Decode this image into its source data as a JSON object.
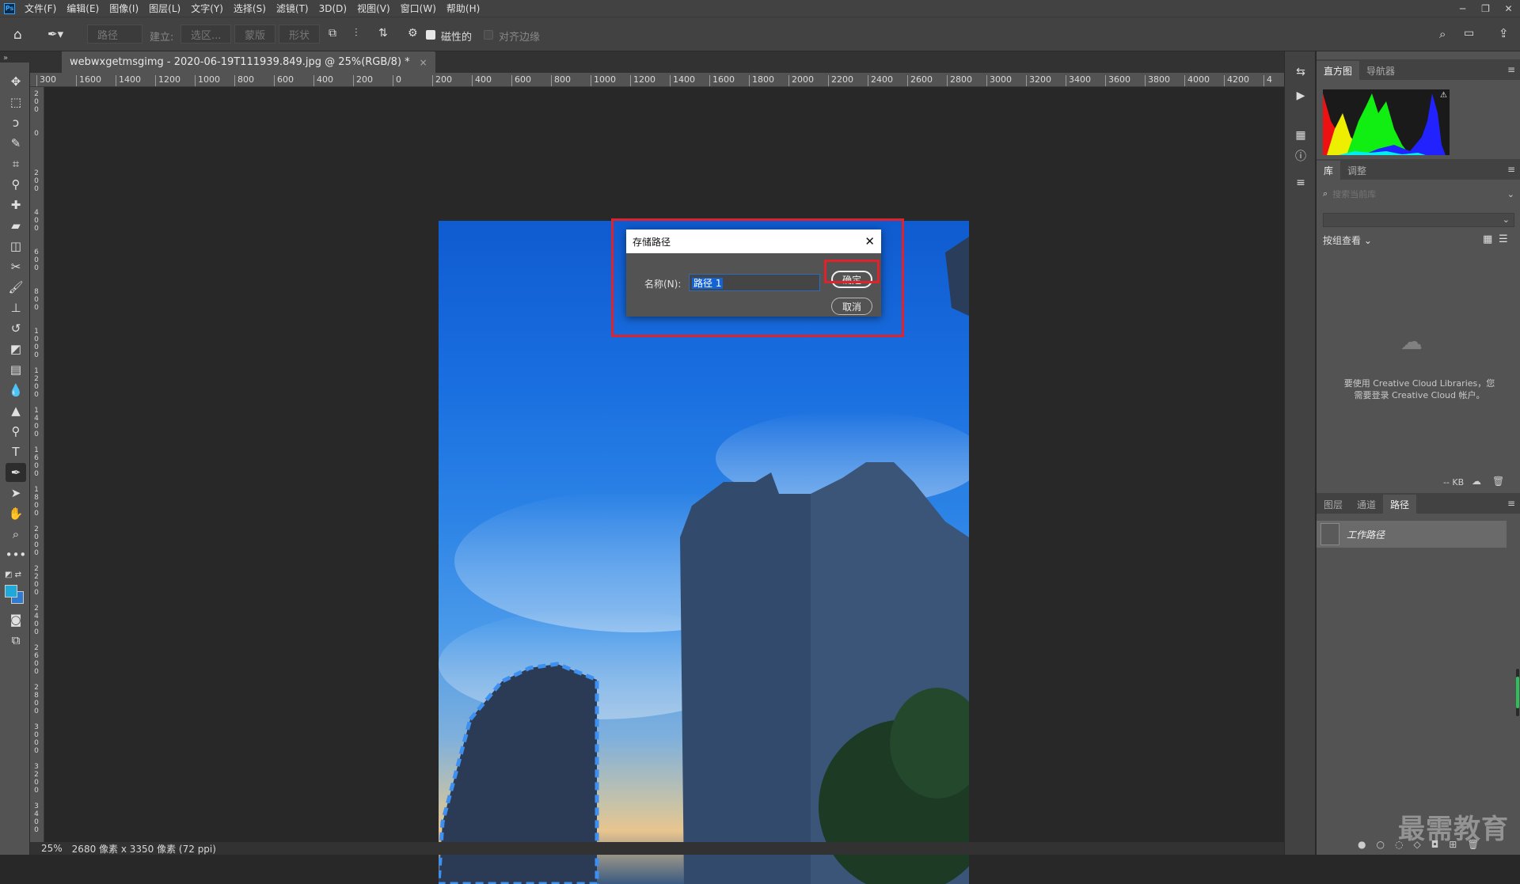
{
  "app": {
    "logo": "Ps"
  },
  "menu": [
    "文件(F)",
    "编辑(E)",
    "图像(I)",
    "图层(L)",
    "文字(Y)",
    "选择(S)",
    "滤镜(T)",
    "3D(D)",
    "视图(V)",
    "窗口(W)",
    "帮助(H)"
  ],
  "options": {
    "mode": "路径",
    "make_label": "建立:",
    "selection_btn": "选区...",
    "mask_btn": "蒙版",
    "shape_btn": "形状",
    "magnetic_label": "磁性的",
    "align_edges_label": "对齐边缘"
  },
  "document": {
    "tab_title": "webwxgetmsgimg - 2020-06-19T111939.849.jpg @ 25%(RGB/8) *",
    "close": "×",
    "zoom": "25%",
    "status": "2680 像素 x 3350 像素 (72 ppi)"
  },
  "ruler_h": [
    "300",
    "1600",
    "1400",
    "1200",
    "1000",
    "800",
    "600",
    "400",
    "200",
    "0",
    "200",
    "400",
    "600",
    "800",
    "1000",
    "1200",
    "1400",
    "1600",
    "1800",
    "2000",
    "2200",
    "2400",
    "2600",
    "2800",
    "3000",
    "3200",
    "3400",
    "3600",
    "3800",
    "4000",
    "4200",
    "4"
  ],
  "ruler_v": [
    "200",
    "0",
    "200",
    "400",
    "600",
    "800",
    "1000",
    "1200",
    "1400",
    "1600",
    "1800",
    "2000",
    "2200",
    "2400",
    "2600",
    "2800",
    "3000",
    "3200",
    "3400"
  ],
  "dialog": {
    "title": "存储路径",
    "name_label": "名称(N):",
    "name_value": "路径 1",
    "ok": "确定",
    "cancel": "取消"
  },
  "panels": {
    "top_tabs": [
      "直方图",
      "导航器"
    ],
    "mid_tabs": [
      "库",
      "调整"
    ],
    "library_search_placeholder": "搜索当前库",
    "view_by_group": "按组查看",
    "cc_message_1": "要使用 Creative Cloud Libraries，您",
    "cc_message_2": "需要登录 Creative Cloud 帐户。",
    "kb": "-- KB",
    "bottom_tabs": [
      "图层",
      "通道",
      "路径"
    ],
    "work_path": "工作路径"
  },
  "watermark": "最需教育",
  "colors": {
    "accent_red": "#e0222a",
    "foreground": "#1fa9d8",
    "background": "#2f7bd0"
  }
}
